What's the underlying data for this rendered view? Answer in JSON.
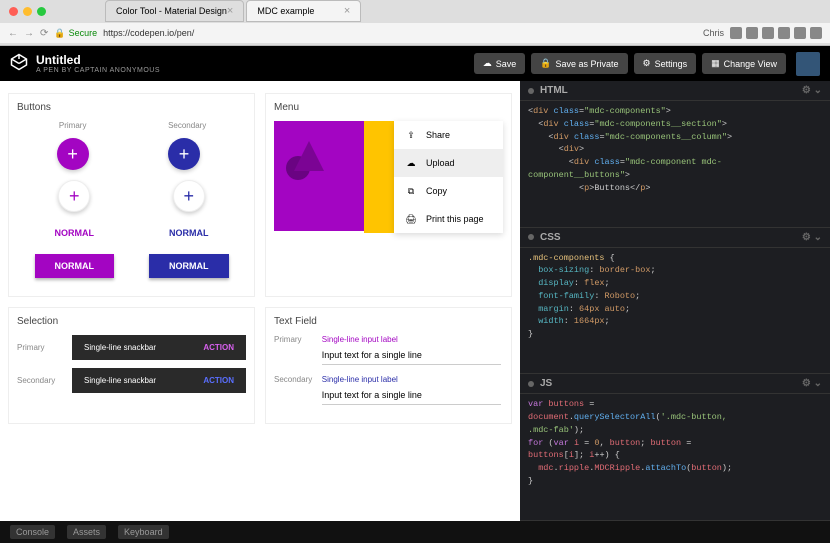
{
  "browser": {
    "tabs": [
      {
        "title": "Color Tool - Material Design",
        "active": false
      },
      {
        "title": "MDC example",
        "active": true
      }
    ],
    "secure_label": "Secure",
    "url": "https://codepen.io/pen/",
    "user_label": "Chris"
  },
  "codepen": {
    "title": "Untitled",
    "subtitle": "A PEN BY CAPTAIN ANONYMOUS",
    "actions": {
      "save": "Save",
      "save_private": "Save as Private",
      "settings": "Settings",
      "change_view": "Change View"
    },
    "footer": [
      "Console",
      "Assets",
      "Keyboard"
    ]
  },
  "preview": {
    "buttons": {
      "title": "Buttons",
      "primary_label": "Primary",
      "secondary_label": "Secondary",
      "normal_label": "NORMAL"
    },
    "menu": {
      "title": "Menu",
      "items": [
        {
          "icon": "share",
          "label": "Share"
        },
        {
          "icon": "upload",
          "label": "Upload",
          "active": true
        },
        {
          "icon": "copy",
          "label": "Copy"
        },
        {
          "icon": "print",
          "label": "Print this page"
        }
      ]
    },
    "selection": {
      "title": "Selection",
      "primary_label": "Primary",
      "secondary_label": "Secondary",
      "snackbar_text": "Single-line snackbar",
      "action_label": "ACTION"
    },
    "textfield": {
      "title": "Text Field",
      "primary_label": "Primary",
      "secondary_label": "Secondary",
      "input_label": "Single-line input label",
      "input_value": "Input text for a single line"
    }
  },
  "editors": {
    "html": {
      "title": "HTML",
      "lines": [
        "<div class=\"mdc-components\">",
        "  <div class=\"mdc-components__section\">",
        "    <div class=\"mdc-components__column\">",
        "      <div>",
        "        <div class=\"mdc-component mdc-component__buttons\">",
        "          <p>Buttons</p>"
      ]
    },
    "css": {
      "title": "CSS",
      "lines": [
        ".mdc-components {",
        "  box-sizing: border-box;",
        "  display: flex;",
        "  font-family: Roboto;",
        "  margin: 64px auto;",
        "  width: 1664px;",
        "}"
      ]
    },
    "js": {
      "title": "JS",
      "lines": [
        "var buttons = document.querySelectorAll('.mdc-button, .mdc-fab');",
        "for (var i = 0, button; button = buttons[i]; i++) {",
        "  mdc.ripple.MDCRipple.attachTo(button);",
        "}"
      ]
    }
  }
}
